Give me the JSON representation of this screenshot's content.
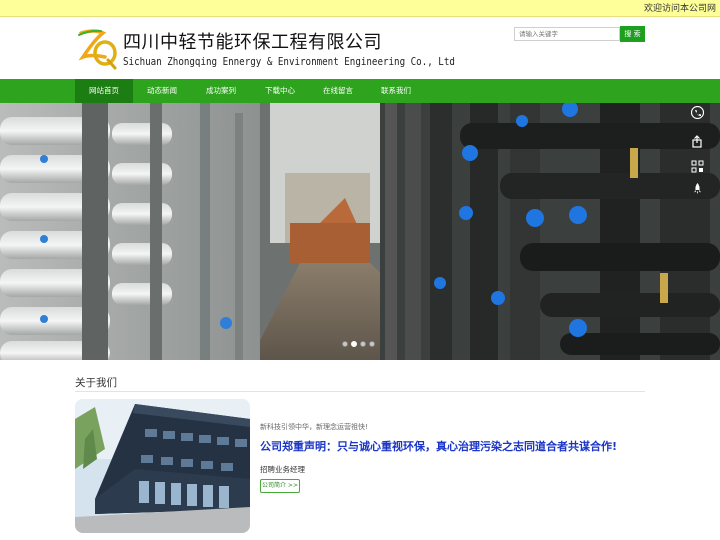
{
  "topbar": {
    "welcome": "欢迎访问本公司网"
  },
  "header": {
    "company_name_cn": "四川中轻节能环保工程有限公司",
    "company_name_en": "Sichuan Zhongqing Ennergy & Environment Engineering Co., Ltd",
    "logo_text": "ZQ",
    "logo_icon": "zq-logo"
  },
  "search": {
    "placeholder": "请输入关键字",
    "button_label": "搜 索"
  },
  "nav": {
    "items": [
      {
        "label": "网站首页",
        "active": true
      },
      {
        "label": "动态新闻",
        "active": false
      },
      {
        "label": "成功案列",
        "active": false
      },
      {
        "label": "下载中心",
        "active": false
      },
      {
        "label": "在线留言",
        "active": false
      },
      {
        "label": "联系我们",
        "active": false
      }
    ]
  },
  "banner": {
    "image": "industrial water treatment piping hall",
    "slides": 4,
    "active_slide": 2
  },
  "side_tools": [
    "phone-icon",
    "share-icon",
    "qr-code-icon",
    "rocket-top-icon"
  ],
  "about": {
    "section_title": "关于我们",
    "image": "modern company building",
    "slogan": "新科技引领中华，新理念运营祖快!",
    "headline": "公司郑重声明：只与诚心重视环保，真心治理污染之志同道合者共谋合作!",
    "recruit": "招聘业务经理",
    "intro_button": "公司简介 >>"
  },
  "colors": {
    "nav_green": "#2ea31e",
    "nav_active": "#1b7d12",
    "topbar_yellow": "#ffff99",
    "headline_blue": "#1a35c8"
  }
}
